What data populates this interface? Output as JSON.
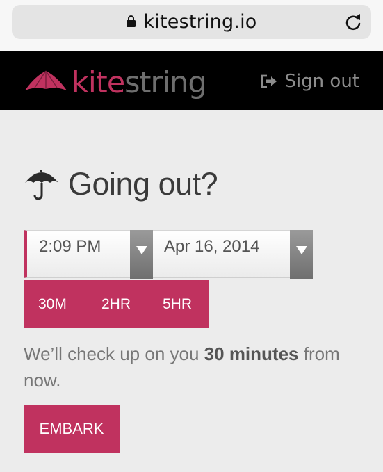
{
  "browser": {
    "url": "kitestring.io",
    "lock_icon": "lock-icon",
    "reload_icon": "reload-icon"
  },
  "header": {
    "brand_kite": "kite",
    "brand_string": "string",
    "signout_label": "Sign out",
    "signout_icon": "sign-out-icon",
    "logo_icon": "kite-logo-icon"
  },
  "main": {
    "title": "Going out?",
    "title_icon": "umbrella-icon",
    "time_value": "2:09 PM",
    "date_value": "Apr 16, 2014",
    "durations": [
      {
        "label": "30M"
      },
      {
        "label": "2HR"
      },
      {
        "label": "5HR"
      }
    ],
    "checkup_prefix": "We’ll check up on you ",
    "checkup_duration": "30 minutes",
    "checkup_suffix": " from now.",
    "embark_label": "EMBARK"
  },
  "colors": {
    "accent": "#c0325f",
    "header_bg": "#000000",
    "page_bg": "#ececec"
  }
}
